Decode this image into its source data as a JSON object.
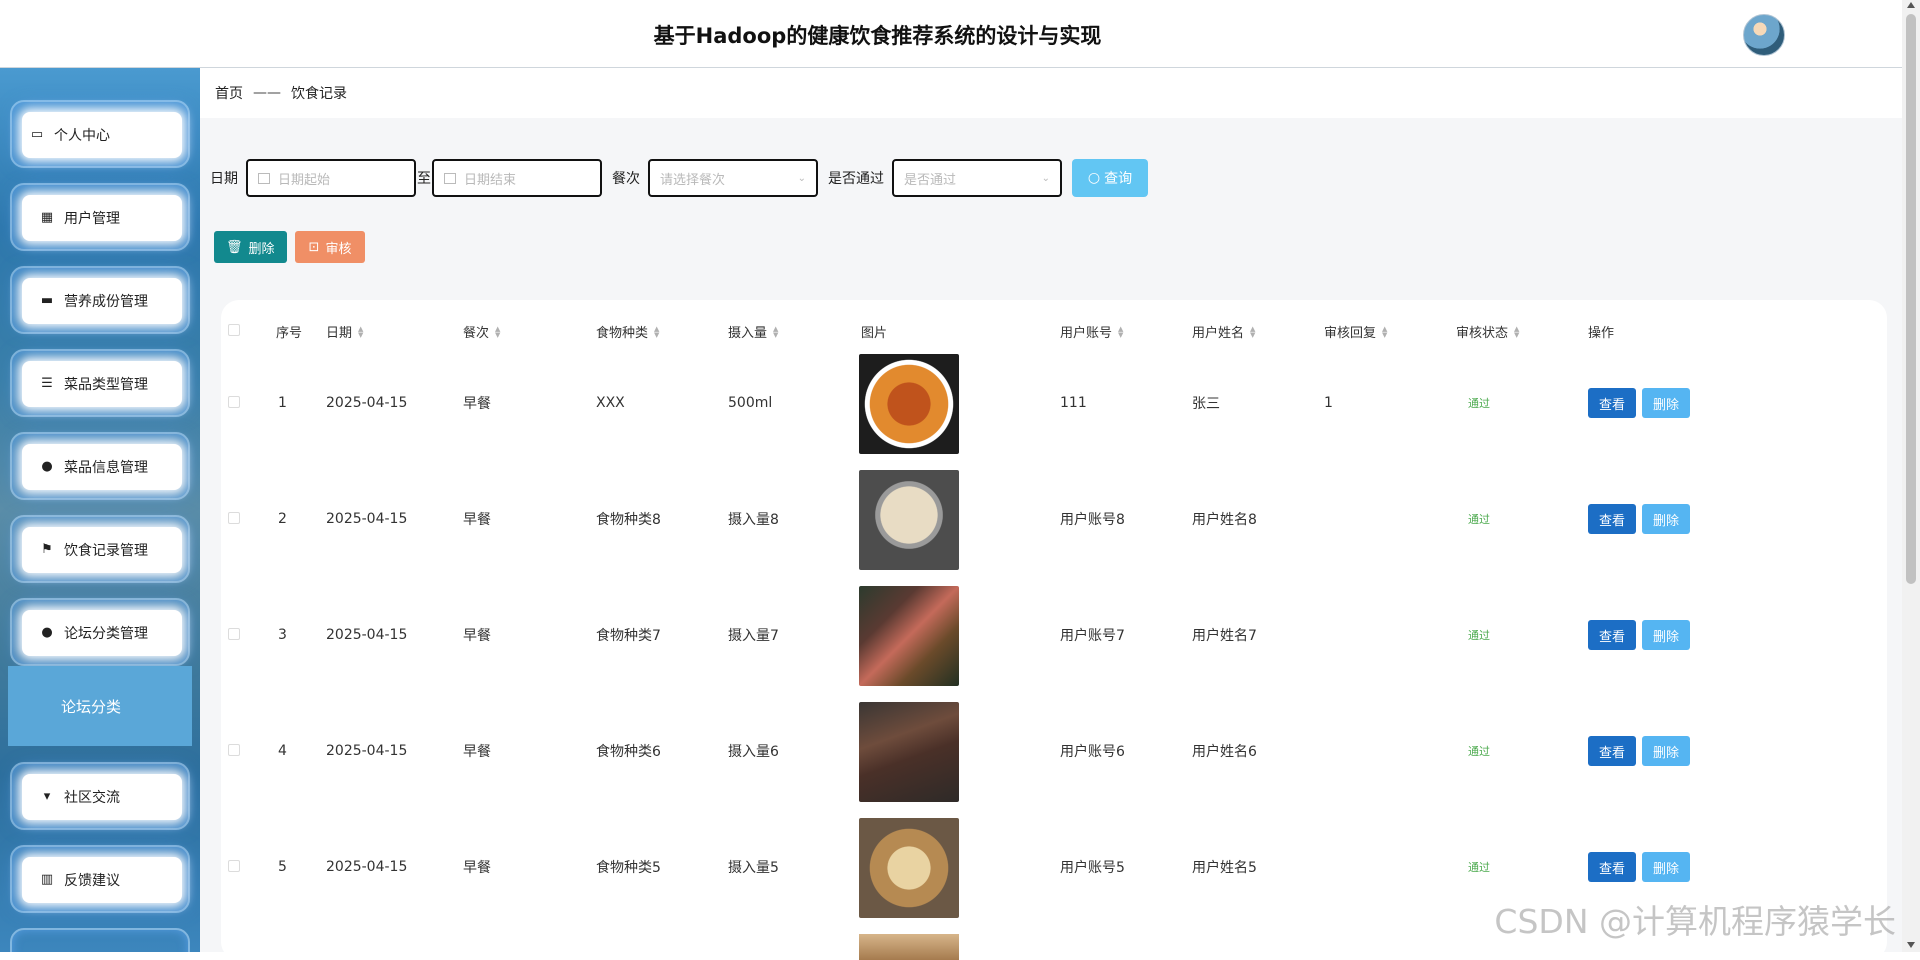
{
  "header": {
    "title": "基于Hadoop的健康饮食推荐系统的设计与实现"
  },
  "sidebar": {
    "items": [
      {
        "label": "个人中心",
        "icon": "id-card-icon"
      },
      {
        "label": "用户管理",
        "icon": "grid-icon"
      },
      {
        "label": "营养成份管理",
        "icon": "briefcase-icon"
      },
      {
        "label": "菜品类型管理",
        "icon": "list-icon"
      },
      {
        "label": "菜品信息管理",
        "icon": "user-icon"
      },
      {
        "label": "饮食记录管理",
        "icon": "flag-icon"
      },
      {
        "label": "论坛分类管理",
        "icon": "bulb-icon"
      },
      {
        "label": "社区交流",
        "icon": "brush-icon"
      },
      {
        "label": "反馈建议",
        "icon": "books-icon"
      }
    ],
    "submenu": {
      "label": "论坛分类"
    }
  },
  "breadcrumb": {
    "home": "首页",
    "sep": "——",
    "current": "饮食记录"
  },
  "filter": {
    "date_label": "日期",
    "start_placeholder": "日期起始",
    "to_label": "至",
    "end_placeholder": "日期结束",
    "meal_label": "餐次",
    "meal_placeholder": "请选择餐次",
    "pass_label": "是否通过",
    "pass_placeholder": "是否通过",
    "search_label": "查询"
  },
  "actions": {
    "delete_label": "删除",
    "audit_label": "审核"
  },
  "table": {
    "columns": [
      "序号",
      "日期",
      "餐次",
      "食物种类",
      "摄入量",
      "图片",
      "用户账号",
      "用户姓名",
      "审核回复",
      "审核状态",
      "操作"
    ],
    "view_label": "查看",
    "delete_label": "删除",
    "rows": [
      {
        "idx": "1",
        "date": "2025-04-15",
        "meal": "早餐",
        "food": "XXX",
        "amount": "500ml",
        "account": "111",
        "name": "张三",
        "reply": "1",
        "status": "通过"
      },
      {
        "idx": "2",
        "date": "2025-04-15",
        "meal": "早餐",
        "food": "食物种类8",
        "amount": "摄入量8",
        "account": "用户账号8",
        "name": "用户姓名8",
        "reply": "",
        "status": "通过"
      },
      {
        "idx": "3",
        "date": "2025-04-15",
        "meal": "早餐",
        "food": "食物种类7",
        "amount": "摄入量7",
        "account": "用户账号7",
        "name": "用户姓名7",
        "reply": "",
        "status": "通过"
      },
      {
        "idx": "4",
        "date": "2025-04-15",
        "meal": "早餐",
        "food": "食物种类6",
        "amount": "摄入量6",
        "account": "用户账号6",
        "name": "用户姓名6",
        "reply": "",
        "status": "通过"
      },
      {
        "idx": "5",
        "date": "2025-04-15",
        "meal": "早餐",
        "food": "食物种类5",
        "amount": "摄入量5",
        "account": "用户账号5",
        "name": "用户姓名5",
        "reply": "",
        "status": "通过"
      }
    ]
  },
  "watermark": "CSDN @计算机程序猿学长"
}
